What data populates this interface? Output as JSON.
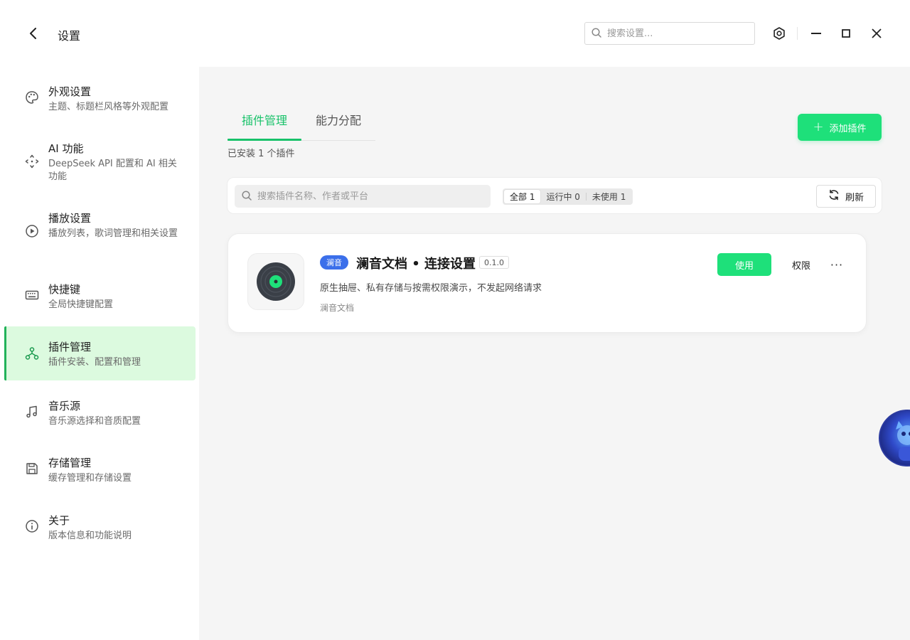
{
  "header": {
    "title": "设置",
    "search_placeholder": "搜索设置..."
  },
  "sidebar": {
    "items": [
      {
        "title": "外观设置",
        "desc": "主题、标题栏风格等外观配置",
        "icon": "palette-icon"
      },
      {
        "title": "AI 功能",
        "desc": "DeepSeek API 配置和 AI 相关功能",
        "icon": "ai-diamond-icon"
      },
      {
        "title": "播放设置",
        "desc": "播放列表，歌词管理和相关设置",
        "icon": "play-circle-icon"
      },
      {
        "title": "快捷键",
        "desc": "全局快捷键配置",
        "icon": "keyboard-icon"
      },
      {
        "title": "插件管理",
        "desc": "插件安装、配置和管理",
        "icon": "plugin-tree-icon",
        "active": true
      },
      {
        "title": "音乐源",
        "desc": "音乐源选择和音质配置",
        "icon": "music-note-icon"
      },
      {
        "title": "存储管理",
        "desc": "缓存管理和存储设置",
        "icon": "save-icon"
      },
      {
        "title": "关于",
        "desc": "版本信息和功能说明",
        "icon": "info-icon"
      }
    ]
  },
  "main": {
    "tabs": [
      {
        "label": "插件管理",
        "active": true
      },
      {
        "label": "能力分配",
        "active": false
      }
    ],
    "installed_text": "已安装 1 个插件",
    "add_button": "添加插件",
    "search_placeholder": "搜索插件名称、作者或平台",
    "filters": [
      {
        "label": "全部 1",
        "active": true
      },
      {
        "label": "运行中 0",
        "active": false
      },
      {
        "label": "未使用 1",
        "active": false
      }
    ],
    "refresh_label": "刷新",
    "plugins": [
      {
        "badge": "澜音",
        "name": "澜音文档 • 连接设置",
        "version": "0.1.0",
        "description": "原生抽屉、私有存储与按需权限演示，不发起网络请求",
        "author": "澜音文档",
        "use_label": "使用",
        "perm_label": "权限",
        "more_label": "···",
        "icon": "vinyl-record-icon"
      }
    ]
  },
  "colors": {
    "accent": "#1ee07a",
    "active_tab": "#19c26a",
    "active_nav_bg": "#dcfadf",
    "badge": "#3b6fea",
    "main_bg": "#f5f5f5"
  }
}
